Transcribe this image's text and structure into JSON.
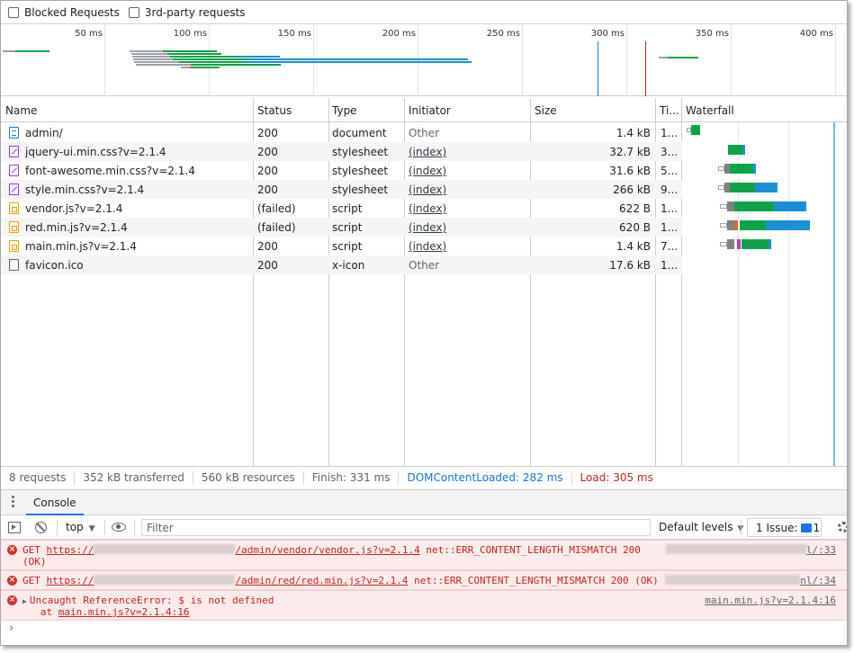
{
  "filters": {
    "blocked_requests": "Blocked Requests",
    "third_party": "3rd-party requests"
  },
  "overview": {
    "ticks": [
      "50 ms",
      "100 ms",
      "150 ms",
      "200 ms",
      "250 ms",
      "300 ms",
      "350 ms",
      "400 ms"
    ]
  },
  "table": {
    "headers": {
      "name": "Name",
      "status": "Status",
      "type": "Type",
      "initiator": "Initiator",
      "size": "Size",
      "time": "Ti...",
      "waterfall": "Waterfall"
    },
    "rows": [
      {
        "icon": "document-icon",
        "name": "admin/",
        "status": "200",
        "type": "document",
        "initiator": "Other",
        "size": "1.4 kB",
        "time": "1..."
      },
      {
        "icon": "stylesheet-icon",
        "name": "jquery-ui.min.css?v=2.1.4",
        "status": "200",
        "type": "stylesheet",
        "initiator": "(index)",
        "size": "32.7 kB",
        "time": "3..."
      },
      {
        "icon": "stylesheet-icon",
        "name": "font-awesome.min.css?v=2.1.4",
        "status": "200",
        "type": "stylesheet",
        "initiator": "(index)",
        "size": "31.6 kB",
        "time": "5..."
      },
      {
        "icon": "stylesheet-icon",
        "name": "style.min.css?v=2.1.4",
        "status": "200",
        "type": "stylesheet",
        "initiator": "(index)",
        "size": "266 kB",
        "time": "9..."
      },
      {
        "icon": "script-icon",
        "name": "vendor.js?v=2.1.4",
        "status": "(failed)",
        "type": "script",
        "initiator": "(index)",
        "size": "622 B",
        "time": "1..."
      },
      {
        "icon": "script-icon",
        "name": "red.min.js?v=2.1.4",
        "status": "(failed)",
        "type": "script",
        "initiator": "(index)",
        "size": "620 B",
        "time": "1..."
      },
      {
        "icon": "script-icon",
        "name": "main.min.js?v=2.1.4",
        "status": "200",
        "type": "script",
        "initiator": "(index)",
        "size": "1.4 kB",
        "time": "7..."
      },
      {
        "icon": "file-icon",
        "name": "favicon.ico",
        "status": "200",
        "type": "x-icon",
        "initiator": "Other",
        "size": "17.6 kB",
        "time": "1..."
      }
    ]
  },
  "summary": {
    "requests": "8 requests",
    "transferred": "352 kB transferred",
    "resources": "560 kB resources",
    "finish": "Finish: 331 ms",
    "dcl": "DOMContentLoaded: 282 ms",
    "load": "Load: 305 ms"
  },
  "console": {
    "tab_label": "Console",
    "context": "top",
    "filter_placeholder": "Filter",
    "levels": "Default levels",
    "issues_label": "1 Issue:",
    "issues_count": "1",
    "messages": [
      {
        "method": "GET",
        "url_prefix": "https://",
        "url_path": "/admin/vendor/vendor.js?v=2.1.4",
        "error": "net::ERR_CONTENT_LENGTH_MISMATCH 200",
        "error_cont": "(OK)",
        "source_suffix": "l/:33"
      },
      {
        "method": "GET",
        "url_prefix": "https://",
        "url_path": "/admin/red/red.min.js?v=2.1.4",
        "error": "net::ERR_CONTENT_LENGTH_MISMATCH 200 (OK)",
        "source_suffix": "nl/:34"
      },
      {
        "text": "Uncaught ReferenceError: $ is not defined",
        "at_label": "at",
        "at_link": "main.min.js?v=2.1.4:16",
        "source": "main.min.js?v=2.1.4:16"
      }
    ]
  },
  "colors": {
    "green": "#0ea34a",
    "blue": "#1a8fd8",
    "dcl_line": "#1a73e8",
    "load_line": "#c5221f",
    "error_bg": "#fcebeb"
  }
}
